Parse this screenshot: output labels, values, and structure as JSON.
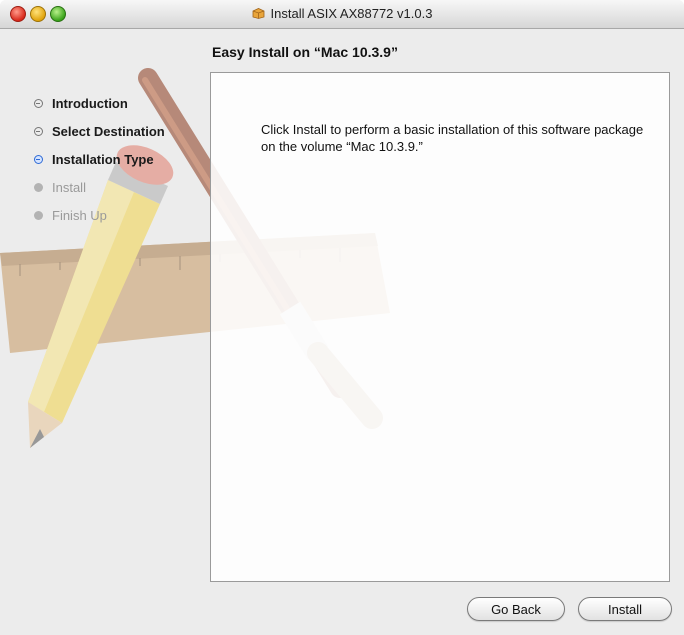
{
  "window": {
    "title": "Install ASIX AX88772 v1.0.3"
  },
  "header": {
    "title": "Easy Install on “Mac 10.3.9”"
  },
  "sidebar": {
    "steps": [
      {
        "label": "Introduction",
        "state": "done"
      },
      {
        "label": "Select Destination",
        "state": "done"
      },
      {
        "label": "Installation Type",
        "state": "current"
      },
      {
        "label": "Install",
        "state": "pending"
      },
      {
        "label": "Finish Up",
        "state": "pending"
      }
    ]
  },
  "main": {
    "message": "Click Install to perform a basic installation of this software package on the volume “Mac 10.3.9.”"
  },
  "buttons": {
    "go_back": "Go Back",
    "install": "Install"
  },
  "colors": {
    "current_step": "#2f6bd6",
    "pending_step": "#9a9a9a"
  },
  "icons": {
    "title": "package-icon",
    "artwork": "installer-pencil-brush-ruler"
  }
}
